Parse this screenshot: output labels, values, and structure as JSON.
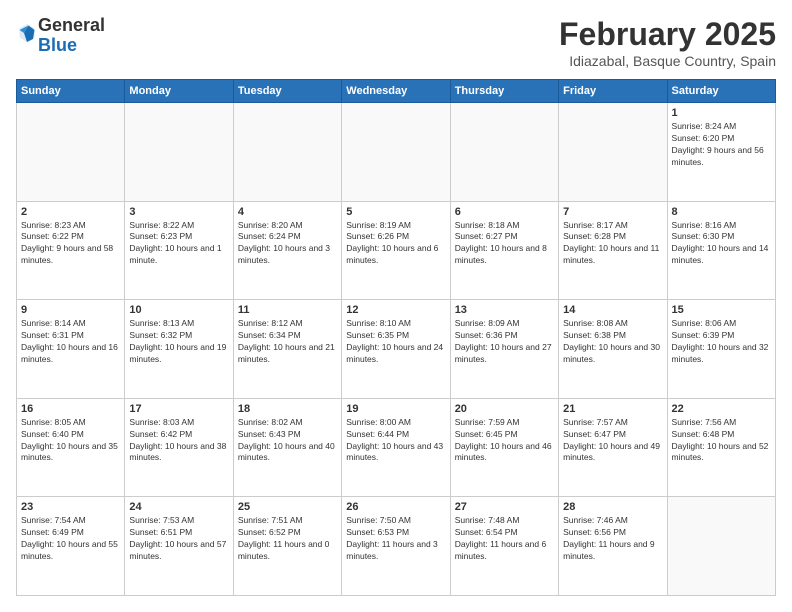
{
  "logo": {
    "general": "General",
    "blue": "Blue"
  },
  "header": {
    "title": "February 2025",
    "location": "Idiazabal, Basque Country, Spain"
  },
  "weekdays": [
    "Sunday",
    "Monday",
    "Tuesday",
    "Wednesday",
    "Thursday",
    "Friday",
    "Saturday"
  ],
  "weeks": [
    {
      "days": [
        {
          "num": "",
          "info": "",
          "empty": true
        },
        {
          "num": "",
          "info": "",
          "empty": true
        },
        {
          "num": "",
          "info": "",
          "empty": true
        },
        {
          "num": "",
          "info": "",
          "empty": true
        },
        {
          "num": "",
          "info": "",
          "empty": true
        },
        {
          "num": "",
          "info": "",
          "empty": true
        },
        {
          "num": "1",
          "info": "Sunrise: 8:24 AM\nSunset: 6:20 PM\nDaylight: 9 hours and 56 minutes.",
          "empty": false
        }
      ]
    },
    {
      "days": [
        {
          "num": "2",
          "info": "Sunrise: 8:23 AM\nSunset: 6:22 PM\nDaylight: 9 hours and 58 minutes.",
          "empty": false
        },
        {
          "num": "3",
          "info": "Sunrise: 8:22 AM\nSunset: 6:23 PM\nDaylight: 10 hours and 1 minute.",
          "empty": false
        },
        {
          "num": "4",
          "info": "Sunrise: 8:20 AM\nSunset: 6:24 PM\nDaylight: 10 hours and 3 minutes.",
          "empty": false
        },
        {
          "num": "5",
          "info": "Sunrise: 8:19 AM\nSunset: 6:26 PM\nDaylight: 10 hours and 6 minutes.",
          "empty": false
        },
        {
          "num": "6",
          "info": "Sunrise: 8:18 AM\nSunset: 6:27 PM\nDaylight: 10 hours and 8 minutes.",
          "empty": false
        },
        {
          "num": "7",
          "info": "Sunrise: 8:17 AM\nSunset: 6:28 PM\nDaylight: 10 hours and 11 minutes.",
          "empty": false
        },
        {
          "num": "8",
          "info": "Sunrise: 8:16 AM\nSunset: 6:30 PM\nDaylight: 10 hours and 14 minutes.",
          "empty": false
        }
      ]
    },
    {
      "days": [
        {
          "num": "9",
          "info": "Sunrise: 8:14 AM\nSunset: 6:31 PM\nDaylight: 10 hours and 16 minutes.",
          "empty": false
        },
        {
          "num": "10",
          "info": "Sunrise: 8:13 AM\nSunset: 6:32 PM\nDaylight: 10 hours and 19 minutes.",
          "empty": false
        },
        {
          "num": "11",
          "info": "Sunrise: 8:12 AM\nSunset: 6:34 PM\nDaylight: 10 hours and 21 minutes.",
          "empty": false
        },
        {
          "num": "12",
          "info": "Sunrise: 8:10 AM\nSunset: 6:35 PM\nDaylight: 10 hours and 24 minutes.",
          "empty": false
        },
        {
          "num": "13",
          "info": "Sunrise: 8:09 AM\nSunset: 6:36 PM\nDaylight: 10 hours and 27 minutes.",
          "empty": false
        },
        {
          "num": "14",
          "info": "Sunrise: 8:08 AM\nSunset: 6:38 PM\nDaylight: 10 hours and 30 minutes.",
          "empty": false
        },
        {
          "num": "15",
          "info": "Sunrise: 8:06 AM\nSunset: 6:39 PM\nDaylight: 10 hours and 32 minutes.",
          "empty": false
        }
      ]
    },
    {
      "days": [
        {
          "num": "16",
          "info": "Sunrise: 8:05 AM\nSunset: 6:40 PM\nDaylight: 10 hours and 35 minutes.",
          "empty": false
        },
        {
          "num": "17",
          "info": "Sunrise: 8:03 AM\nSunset: 6:42 PM\nDaylight: 10 hours and 38 minutes.",
          "empty": false
        },
        {
          "num": "18",
          "info": "Sunrise: 8:02 AM\nSunset: 6:43 PM\nDaylight: 10 hours and 40 minutes.",
          "empty": false
        },
        {
          "num": "19",
          "info": "Sunrise: 8:00 AM\nSunset: 6:44 PM\nDaylight: 10 hours and 43 minutes.",
          "empty": false
        },
        {
          "num": "20",
          "info": "Sunrise: 7:59 AM\nSunset: 6:45 PM\nDaylight: 10 hours and 46 minutes.",
          "empty": false
        },
        {
          "num": "21",
          "info": "Sunrise: 7:57 AM\nSunset: 6:47 PM\nDaylight: 10 hours and 49 minutes.",
          "empty": false
        },
        {
          "num": "22",
          "info": "Sunrise: 7:56 AM\nSunset: 6:48 PM\nDaylight: 10 hours and 52 minutes.",
          "empty": false
        }
      ]
    },
    {
      "days": [
        {
          "num": "23",
          "info": "Sunrise: 7:54 AM\nSunset: 6:49 PM\nDaylight: 10 hours and 55 minutes.",
          "empty": false
        },
        {
          "num": "24",
          "info": "Sunrise: 7:53 AM\nSunset: 6:51 PM\nDaylight: 10 hours and 57 minutes.",
          "empty": false
        },
        {
          "num": "25",
          "info": "Sunrise: 7:51 AM\nSunset: 6:52 PM\nDaylight: 11 hours and 0 minutes.",
          "empty": false
        },
        {
          "num": "26",
          "info": "Sunrise: 7:50 AM\nSunset: 6:53 PM\nDaylight: 11 hours and 3 minutes.",
          "empty": false
        },
        {
          "num": "27",
          "info": "Sunrise: 7:48 AM\nSunset: 6:54 PM\nDaylight: 11 hours and 6 minutes.",
          "empty": false
        },
        {
          "num": "28",
          "info": "Sunrise: 7:46 AM\nSunset: 6:56 PM\nDaylight: 11 hours and 9 minutes.",
          "empty": false
        },
        {
          "num": "",
          "info": "",
          "empty": true
        }
      ]
    }
  ]
}
